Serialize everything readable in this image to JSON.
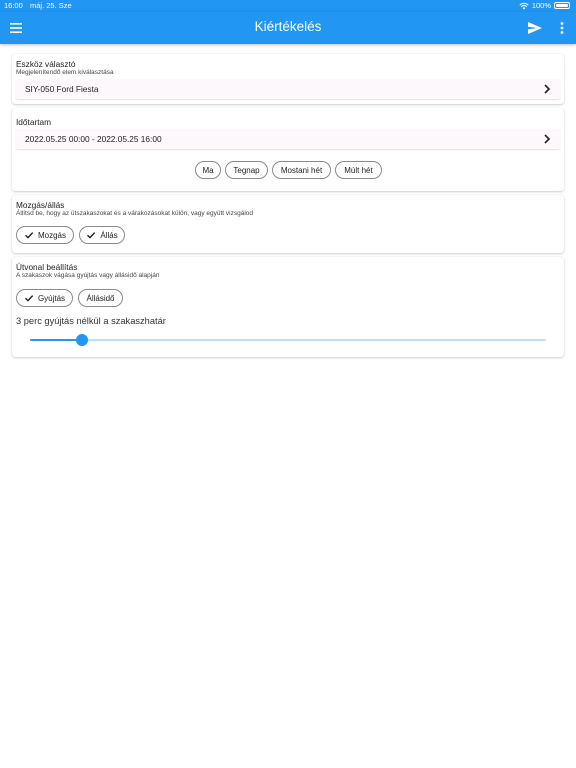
{
  "status_bar": {
    "time": "16:00",
    "date": "máj. 25. Sze",
    "battery_text": "100%"
  },
  "app_bar": {
    "title": "Kiértékelés",
    "icons": [
      "menu-icon",
      "send-icon",
      "more-vert-icon"
    ]
  },
  "device_card": {
    "title": "Eszköz választó",
    "subtitle": "Megjelenítendő elem kiválasztása",
    "selected": "SIY-050 Ford Fiesta"
  },
  "duration_card": {
    "title": "Időtartam",
    "range": "2022.05.25 00:00 - 2022.05.25 16:00",
    "chips": [
      "Ma",
      "Tegnap",
      "Mostani hét",
      "Múlt hét"
    ]
  },
  "motion_card": {
    "title": "Mozgás/állás",
    "subtitle": "Állítsd be, hogy az útszakaszokat és a várakozásokat külön, vagy együtt vizsgálod",
    "chips": [
      {
        "label": "Mozgás",
        "checked": true
      },
      {
        "label": "Állás",
        "checked": true
      }
    ]
  },
  "route_card": {
    "title": "Útvonal beállítás",
    "subtitle": "A szakaszok vágása gyújtás vagy állásidő alapján",
    "chips": [
      {
        "label": "Gyújtás",
        "checked": true
      },
      {
        "label": "Állásidő",
        "checked": false
      }
    ],
    "slider_label": "3 perc gyújtás nélkül a szakaszhatár",
    "slider_fraction": 0.1
  },
  "colors": {
    "primary": "#2196f3",
    "primary_light": "#bbdefb"
  }
}
